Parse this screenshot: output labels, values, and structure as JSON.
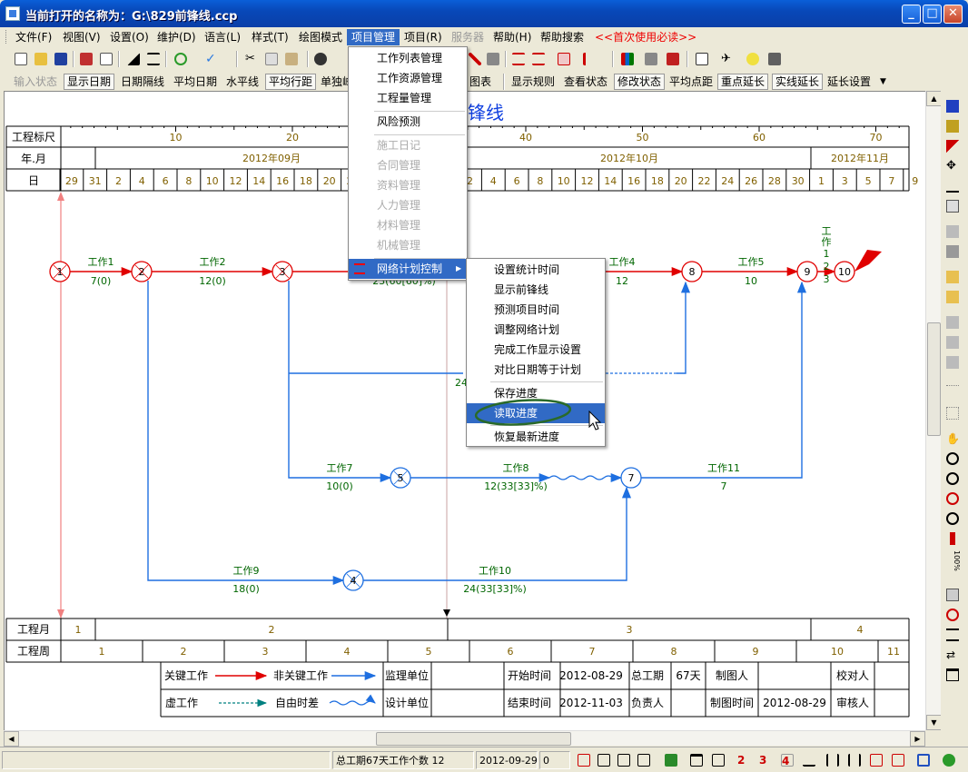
{
  "window": {
    "title": "当前打开的名称为：G:\\829前锋线.ccp"
  },
  "menubar": [
    {
      "label": "文件(F)"
    },
    {
      "label": "视图(V)"
    },
    {
      "label": "设置(O)"
    },
    {
      "label": "维护(D)"
    },
    {
      "label": "语言(L)"
    },
    {
      "label": "样式(T)"
    },
    {
      "label": "绘图模式"
    },
    {
      "label": "项目管理"
    },
    {
      "label": "项目(R)"
    },
    {
      "label": "服务器"
    },
    {
      "label": "帮助(H)"
    },
    {
      "label": "帮助搜索"
    },
    {
      "label": "<<首次使用必读>>"
    }
  ],
  "toolbar2": {
    "items": [
      "输入状态",
      "显示日期",
      "日期隔线",
      "平均日期",
      "水平线",
      "平均行距",
      "单独峰",
      "图表",
      "显示规则",
      "查看状态",
      "修改状态",
      "平均点距",
      "重点延长",
      "实线延长",
      "延长设置"
    ]
  },
  "chart": {
    "title": "锋线",
    "rows": {
      "scale_label": "工程标尺",
      "month_label": "年.月",
      "day_label": "日",
      "proj_month_label": "工程月",
      "proj_week_label": "工程周"
    },
    "scale_ticks": [
      "10",
      "20",
      "30",
      "40",
      "50",
      "60",
      "70"
    ],
    "months": [
      "2012年09月",
      "2012年10月",
      "2012年11月"
    ],
    "days": [
      "29",
      "31",
      "2",
      "4",
      "6",
      "8",
      "10",
      "12",
      "14",
      "16",
      "18",
      "20",
      "22",
      "24",
      "26",
      "28",
      "30",
      "2",
      "4",
      "6",
      "8",
      "10",
      "12",
      "14",
      "16",
      "18",
      "20",
      "22",
      "24",
      "26",
      "28",
      "30",
      "1",
      "3",
      "5",
      "7",
      "9"
    ],
    "proj_months": [
      "1",
      "2",
      "3",
      "4"
    ],
    "proj_weeks": [
      "1",
      "2",
      "3",
      "4",
      "5",
      "6",
      "7",
      "8",
      "9",
      "10",
      "11"
    ],
    "nodes": [
      "1",
      "2",
      "3",
      "4",
      "5",
      "7",
      "8",
      "9",
      "10"
    ],
    "activities": [
      {
        "name": "工作1",
        "value": "7(0)"
      },
      {
        "name": "工作2",
        "value": "12(0)"
      },
      {
        "name": "",
        "value": "23(60[60]%)"
      },
      {
        "name": "工作4",
        "value": "12"
      },
      {
        "name": "工作5",
        "value": "10"
      },
      {
        "name": "工作7",
        "value": "10(0)"
      },
      {
        "name": "工作8",
        "value": "12(33[33]%)"
      },
      {
        "name": "工作11",
        "value": "7"
      },
      {
        "name": "工作9",
        "value": "18(0)"
      },
      {
        "name": "工作10",
        "value": "24(33[33]%)"
      }
    ],
    "vertical_label": {
      "name": "工作",
      "lines": [
        "1",
        "2",
        "3"
      ]
    },
    "partial_label": "24",
    "legend": {
      "critical": "关键工作",
      "noncritical": "非关键工作",
      "supervisor": "监理单位",
      "dummy": "虚工作",
      "free_float": "自由时差",
      "design": "设计单位",
      "start_label": "开始时间",
      "start_value": "2012-08-29",
      "total_label": "总工期",
      "total_value": "67天",
      "drawer_label": "制图人",
      "checker_label": "校对人",
      "end_label": "结束时间",
      "end_value": "2012-11-03",
      "owner_label": "负责人",
      "draw_time_label": "制图时间",
      "draw_time_value": "2012-08-29",
      "reviewer_label": "审核人"
    }
  },
  "project_menu": {
    "items": [
      {
        "label": "工作列表管理",
        "enabled": true
      },
      {
        "label": "工作资源管理",
        "enabled": true
      },
      {
        "label": "工程量管理",
        "enabled": true
      },
      {
        "label": "风险预测",
        "enabled": true
      },
      {
        "label": "施工日记",
        "enabled": false
      },
      {
        "label": "合同管理",
        "enabled": false
      },
      {
        "label": "资料管理",
        "enabled": false
      },
      {
        "label": "人力管理",
        "enabled": false
      },
      {
        "label": "材料管理",
        "enabled": false
      },
      {
        "label": "机械管理",
        "enabled": false
      },
      {
        "label": "网络计划控制",
        "enabled": true
      }
    ]
  },
  "submenu": {
    "items": [
      {
        "label": "设置统计时间"
      },
      {
        "label": "显示前锋线"
      },
      {
        "label": "预测项目时间"
      },
      {
        "label": "调整网络计划"
      },
      {
        "label": "完成工作显示设置"
      },
      {
        "label": "对比日期等于计划"
      },
      {
        "label": "保存进度"
      },
      {
        "label": "读取进度"
      },
      {
        "label": "恢复最新进度"
      }
    ]
  },
  "statusbar": {
    "summary": "总工期67天工作个数 12",
    "date": "2012-09-29",
    "count": "0"
  },
  "colors": {
    "critical": "#E00000",
    "noncritical": "#1E6FE0",
    "label_green": "#006600",
    "grid": "#000000",
    "highlight": "#316AC5"
  }
}
